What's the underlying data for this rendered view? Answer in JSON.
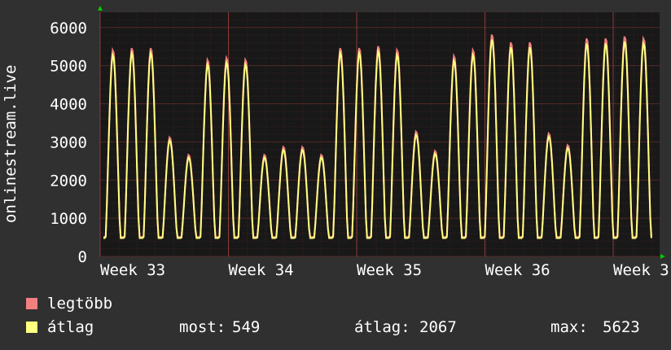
{
  "chart_data": {
    "type": "line",
    "ylabel": "onlinestream.live",
    "yticks": [
      0,
      1000,
      2000,
      3000,
      4000,
      5000,
      6000
    ],
    "ylim": [
      0,
      6400
    ],
    "xticks": [
      "Week 33",
      "Week 34",
      "Week 35",
      "Week 36",
      "Week 3"
    ],
    "grid": true,
    "series": [
      {
        "name": "legtöbb",
        "color": "#f08080"
      },
      {
        "name": "átlag",
        "color": "#ffff80"
      }
    ],
    "daily_peaks": [
      5300,
      5350,
      5350,
      3050,
      2600,
      5050,
      5100,
      5050,
      2600,
      2800,
      2800,
      2600,
      5350,
      5350,
      5400,
      5300,
      3200,
      2700,
      5150,
      5300,
      5700,
      5500,
      5500,
      3150,
      2850,
      5600,
      5600,
      5650,
      5600
    ],
    "stats": {
      "now_label": "most:",
      "now": "549",
      "avg_label": "átlag:",
      "avg": "2067",
      "max_label": "max:",
      "max": "5623"
    }
  },
  "colors": {
    "background": "#303030",
    "plot": "#181818",
    "grid": "#5a2a2a",
    "axis_arrow": "#00cc00",
    "text": "#ffffff"
  }
}
